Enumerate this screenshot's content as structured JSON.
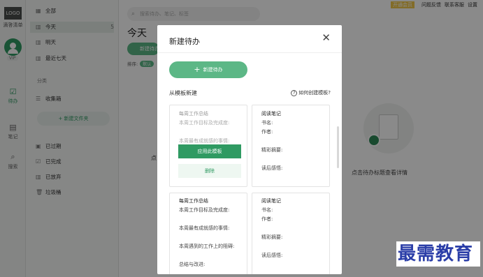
{
  "app": {
    "logo": "LOGO",
    "name": "滴答清单",
    "vip": "VIP"
  },
  "rail": [
    {
      "label": "待办",
      "icon": "☑"
    },
    {
      "label": "笔记",
      "icon": "▤"
    },
    {
      "label": "搜索",
      "icon": "⌕"
    }
  ],
  "lists": {
    "items": [
      {
        "label": "全部",
        "icon": "▦",
        "count": ""
      },
      {
        "label": "今天",
        "icon": "▥",
        "count": "5"
      },
      {
        "label": "明天",
        "icon": "▥",
        "count": ""
      },
      {
        "label": "最近七天",
        "icon": "▥",
        "count": ""
      }
    ],
    "section": "分类",
    "inbox": {
      "label": "收集箱",
      "icon": "☰"
    },
    "new_folder": "+ 新建文件夹",
    "footer": [
      {
        "label": "已过期",
        "icon": "▣"
      },
      {
        "label": "已完成",
        "icon": "☑"
      },
      {
        "label": "已放弃",
        "icon": "▥"
      },
      {
        "label": "垃圾桶",
        "icon": "🗑"
      }
    ]
  },
  "main": {
    "search_placeholder": "搜索待办、笔记、标签",
    "title": "今天",
    "add_button": "新建待办",
    "sort_label": "排序:",
    "sort_value": "默认",
    "empty_fragment": "点",
    "empty_hint": "点击待办标题查看详情"
  },
  "topbar": {
    "renew": "开通会员",
    "links": [
      "问题反馈",
      "联系客服",
      "设置"
    ]
  },
  "modal": {
    "title": "新建待办",
    "create_button": "新建待办",
    "from_template": "从模板新建",
    "how_link": "如何创建模板?",
    "use_button": "应用此模板",
    "delete_button": "删除",
    "weekly_template": [
      "每周工作总结",
      "本周工作目标及完成度:",
      "",
      "本周最有成就感的事情:",
      "",
      "本周遇到的工作上的阻碍:",
      "",
      "总结与改进:"
    ],
    "reading_template": [
      "阅读笔记",
      "书名:",
      "作者:",
      "",
      "精彩摘要:",
      "",
      "读后感悟:"
    ]
  },
  "watermark": "最需教育"
}
